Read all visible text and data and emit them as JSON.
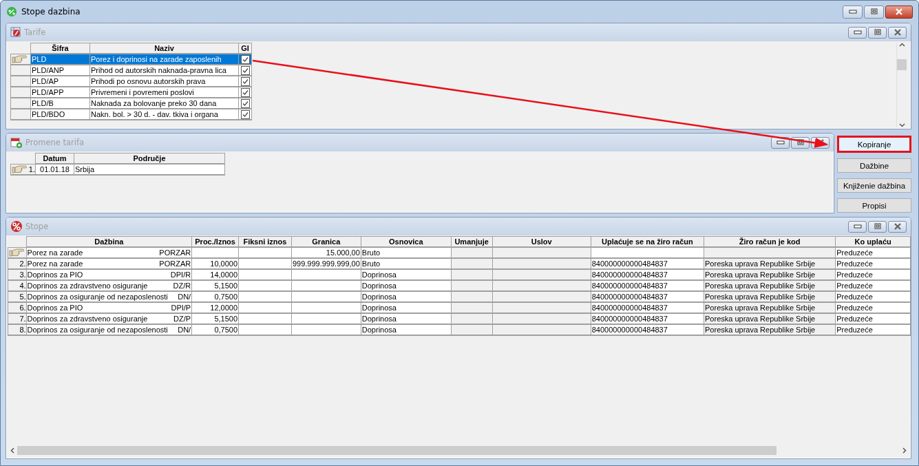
{
  "window": {
    "title": "Stope dazbina"
  },
  "tarife": {
    "title": "Tarife",
    "columns": [
      "Šifra",
      "Naziv",
      "GI"
    ],
    "rows": [
      {
        "sifra": "PLD",
        "naziv": "Porez i doprinosi na zarade zaposlenih",
        "gi": true,
        "selected": true
      },
      {
        "sifra": "PLD/ANP",
        "naziv": "Prihod od autorskih naknada-pravna lica",
        "gi": true,
        "selected": false
      },
      {
        "sifra": "PLD/AP",
        "naziv": "Prihodi po osnovu autorskih prava",
        "gi": true,
        "selected": false
      },
      {
        "sifra": "PLD/APP",
        "naziv": "Privremeni i povremeni poslovi",
        "gi": true,
        "selected": false
      },
      {
        "sifra": "PLD/B",
        "naziv": "Naknada za bolovanje preko 30 dana",
        "gi": true,
        "selected": false
      },
      {
        "sifra": "PLD/BDO",
        "naziv": "Nakn. bol. > 30 d. - dav. tkiva i organa",
        "gi": true,
        "selected": false
      }
    ]
  },
  "promene_tarifa": {
    "title": "Promene tarifa",
    "columns": [
      "Datum",
      "Područje"
    ],
    "rows": [
      {
        "number": "1.",
        "datum": "01.01.18",
        "podrucje": "Srbija",
        "current": true
      }
    ]
  },
  "buttons": [
    {
      "label": "Kopiranje",
      "highlighted": true
    },
    {
      "label": "Dažbine",
      "highlighted": false
    },
    {
      "label": "Knjiženie dažbina",
      "highlighted": false
    },
    {
      "label": "Propisi",
      "highlighted": false
    }
  ],
  "stope": {
    "title": "Stope",
    "columns": [
      "Dažbina",
      "Proc./Iznos",
      "Fiksni iznos",
      "Granica",
      "Osnovica",
      "Umanjuje",
      "Uslov",
      "Uplaćuje se na žiro račun",
      "Žiro račun je kod",
      "Ko uplaću"
    ],
    "rows": [
      {
        "current": true,
        "dazbina": "Porez na zarade",
        "code": "PORZAR",
        "granica": "15.000,00",
        "osnovica": "Bruto",
        "ko": "Preduzeće"
      },
      {
        "number": "2.",
        "current": false,
        "dazbina": "Porez na zarade",
        "code": "PORZAR",
        "proc": "10,0000",
        "granica": "999.999.999.999,00",
        "osnovica": "Bruto",
        "racun": "840000000000484837",
        "ziro_kod": "Poreska uprava Republike Srbije",
        "ko": "Preduzeće"
      },
      {
        "number": "3.",
        "current": false,
        "dazbina": "Doprinos za PIO",
        "code": "DPI/R",
        "proc": "14,0000",
        "osnovica": "Doprinosa",
        "racun": "840000000000484837",
        "ziro_kod": "Poreska uprava Republike Srbije",
        "ko": "Preduzeće"
      },
      {
        "number": "4.",
        "current": false,
        "dazbina": "Doprinos za zdravstveno osiguranje",
        "code": "DZ/R",
        "proc": "5,1500",
        "osnovica": "Doprinosa",
        "racun": "840000000000484837",
        "ziro_kod": "Poreska uprava Republike Srbije",
        "ko": "Preduzeće"
      },
      {
        "number": "5.",
        "current": false,
        "dazbina": "Doprinos za osiguranje od nezaposlenosti",
        "code": "DN/",
        "proc": "0,7500",
        "osnovica": "Doprinosa",
        "racun": "840000000000484837",
        "ziro_kod": "Poreska uprava Republike Srbije",
        "ko": "Preduzeće"
      },
      {
        "number": "6.",
        "current": false,
        "dazbina": "Doprinos za PIO",
        "code": "DPI/P",
        "proc": "12,0000",
        "osnovica": "Doprinosa",
        "racun": "840000000000484837",
        "ziro_kod": "Poreska uprava Republike Srbije",
        "ko": "Preduzeće"
      },
      {
        "number": "7.",
        "current": false,
        "dazbina": "Doprinos za zdravstveno osiguranje",
        "code": "DZ/P",
        "proc": "5,1500",
        "osnovica": "Doprinosa",
        "racun": "840000000000484837",
        "ziro_kod": "Poreska uprava Republike Srbije",
        "ko": "Preduzeće"
      },
      {
        "number": "8.",
        "current": false,
        "dazbina": "Doprinos za osiguranje od nezaposlenosti",
        "code": "DN/",
        "proc": "0,7500",
        "osnovica": "Doprinosa",
        "racun": "840000000000484837",
        "ziro_kod": "Poreska uprava Republike Srbije",
        "ko": "Preduzeće"
      }
    ]
  }
}
